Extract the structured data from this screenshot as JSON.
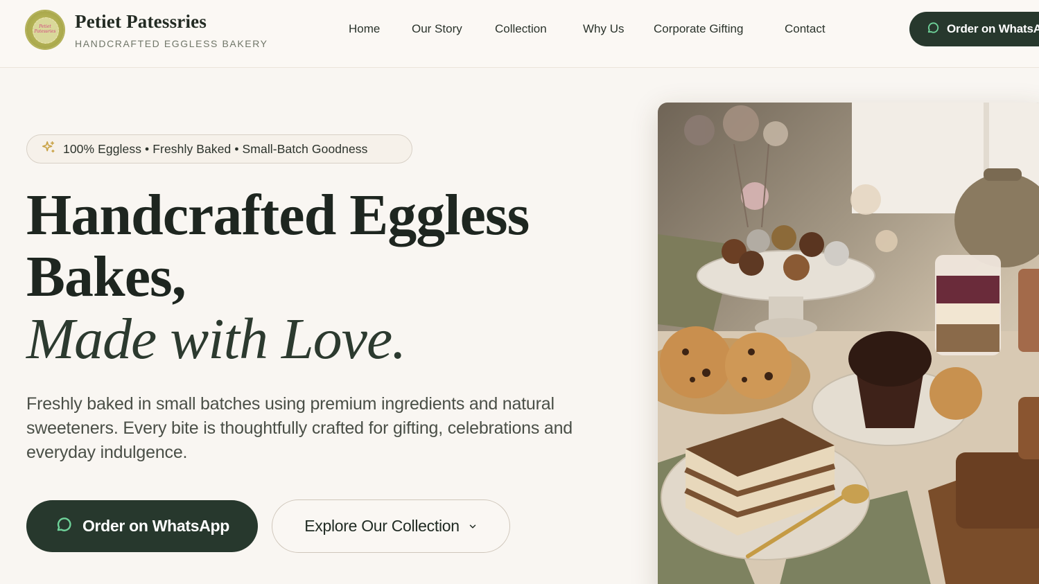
{
  "header": {
    "logo_text": "Petiet Patessries",
    "brand_name": "Petiet Patessries",
    "tagline": "HANDCRAFTED EGGLESS BAKERY",
    "nav": [
      {
        "label": "Home"
      },
      {
        "label": "Our Story"
      },
      {
        "label": "Collection"
      },
      {
        "label": "Why Us"
      },
      {
        "label": "Corporate Gifting"
      },
      {
        "label": "Contact"
      }
    ],
    "order_label": "Order on WhatsApp"
  },
  "hero": {
    "pill_text": "100% Eggless • Freshly Baked • Small-Batch Goodness",
    "headline_line1": "Handcrafted Eggless",
    "headline_line2": "Bakes,",
    "headline_line3": "Made with Love.",
    "description": "Freshly baked in small batches using premium ingredients and natural sweeteners. Every bite is thoughtfully crafted for gifting, celebrations and everyday indulgence.",
    "primary_button": "Order on WhatsApp",
    "secondary_button": "Explore Our Collection"
  },
  "icons": {
    "whatsapp": "chat-bubble-icon",
    "sparkle": "sparkle-icon",
    "chevron": "chevron-down-icon"
  },
  "colors": {
    "background": "#f9f6f2",
    "primary_dark_green": "#27382d",
    "whatsapp_green": "#6fd39a",
    "sparkle_gold": "#c9a347"
  }
}
